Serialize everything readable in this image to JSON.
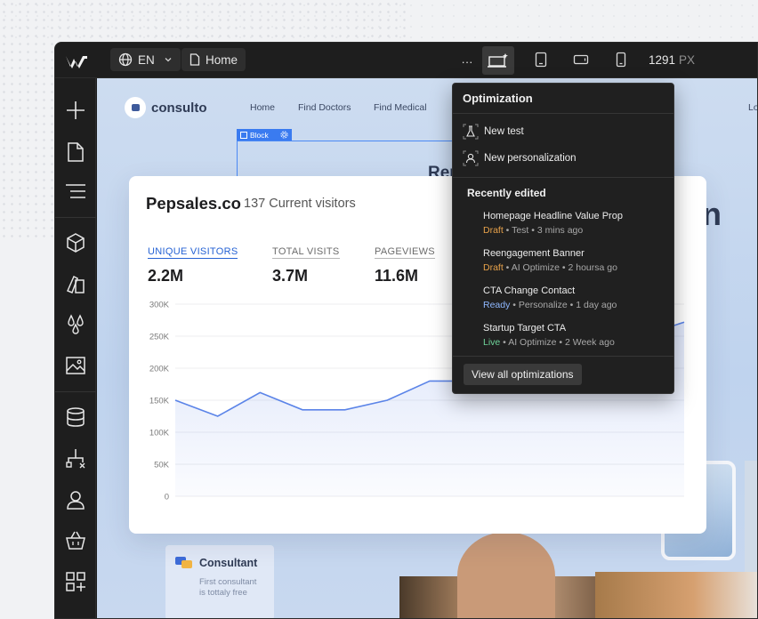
{
  "topbar": {
    "language": "EN",
    "page": "Home",
    "more": "···",
    "width_value": "1291",
    "width_unit": "PX"
  },
  "site": {
    "brand": "consulto",
    "nav": [
      "Home",
      "Find Doctors",
      "Find Medical",
      "Lo"
    ],
    "block_label": "Block",
    "hero_partial": "Rem",
    "hero_partial_right": "n"
  },
  "consultant_card": {
    "title": "Consultant",
    "subtitle_line1": "First consultant",
    "subtitle_line2": "is tottaly free"
  },
  "analytics": {
    "title": "Pepsales.co",
    "subtitle": "137 Current visitors",
    "metrics": [
      {
        "label": "UNIQUE VISITORS",
        "value": "2.2M",
        "active": true
      },
      {
        "label": "TOTAL VISITS",
        "value": "3.7M",
        "active": false
      },
      {
        "label": "PAGEVIEWS",
        "value": "11.6M",
        "active": false
      }
    ]
  },
  "chart_data": {
    "type": "area",
    "y_tick_labels": [
      "300K",
      "250K",
      "200K",
      "150K",
      "100K",
      "50K",
      "0"
    ],
    "ylim": [
      0,
      300000
    ],
    "x": [
      0,
      1,
      2,
      3,
      4,
      5,
      6,
      7,
      8,
      9,
      10,
      11,
      12
    ],
    "series": [
      {
        "values": [
          150000,
          125000,
          162000,
          135000,
          135000,
          150000,
          180000,
          180000,
          205000,
          215000,
          230000,
          250000,
          272000
        ]
      }
    ],
    "color": "#5b84e8",
    "grid": true
  },
  "optimization": {
    "title": "Optimization",
    "actions": [
      {
        "label": "New test",
        "icon": "flask-icon"
      },
      {
        "label": "New personalization",
        "icon": "person-icon"
      }
    ],
    "recent_heading": "Recently edited",
    "recent": [
      {
        "name": "Homepage Headline Value Prop",
        "status": "Draft",
        "type": "Test",
        "time": "3 mins ago"
      },
      {
        "name": "Reengagement Banner",
        "status": "Draft",
        "type": "AI Optimize",
        "time": "2 hoursa go"
      },
      {
        "name": "CTA Change Contact",
        "status": "Ready",
        "type": "Personalize",
        "time": "1 day ago"
      },
      {
        "name": "Startup Target CTA",
        "status": "Live",
        "type": "AI Optimize",
        "time": "2 Week ago"
      }
    ],
    "view_all": "View all optimizations"
  },
  "colors": {
    "accent": "#2562d4",
    "draft": "#e8a24a",
    "ready": "#8fb8ff",
    "live": "#6fd49a"
  }
}
